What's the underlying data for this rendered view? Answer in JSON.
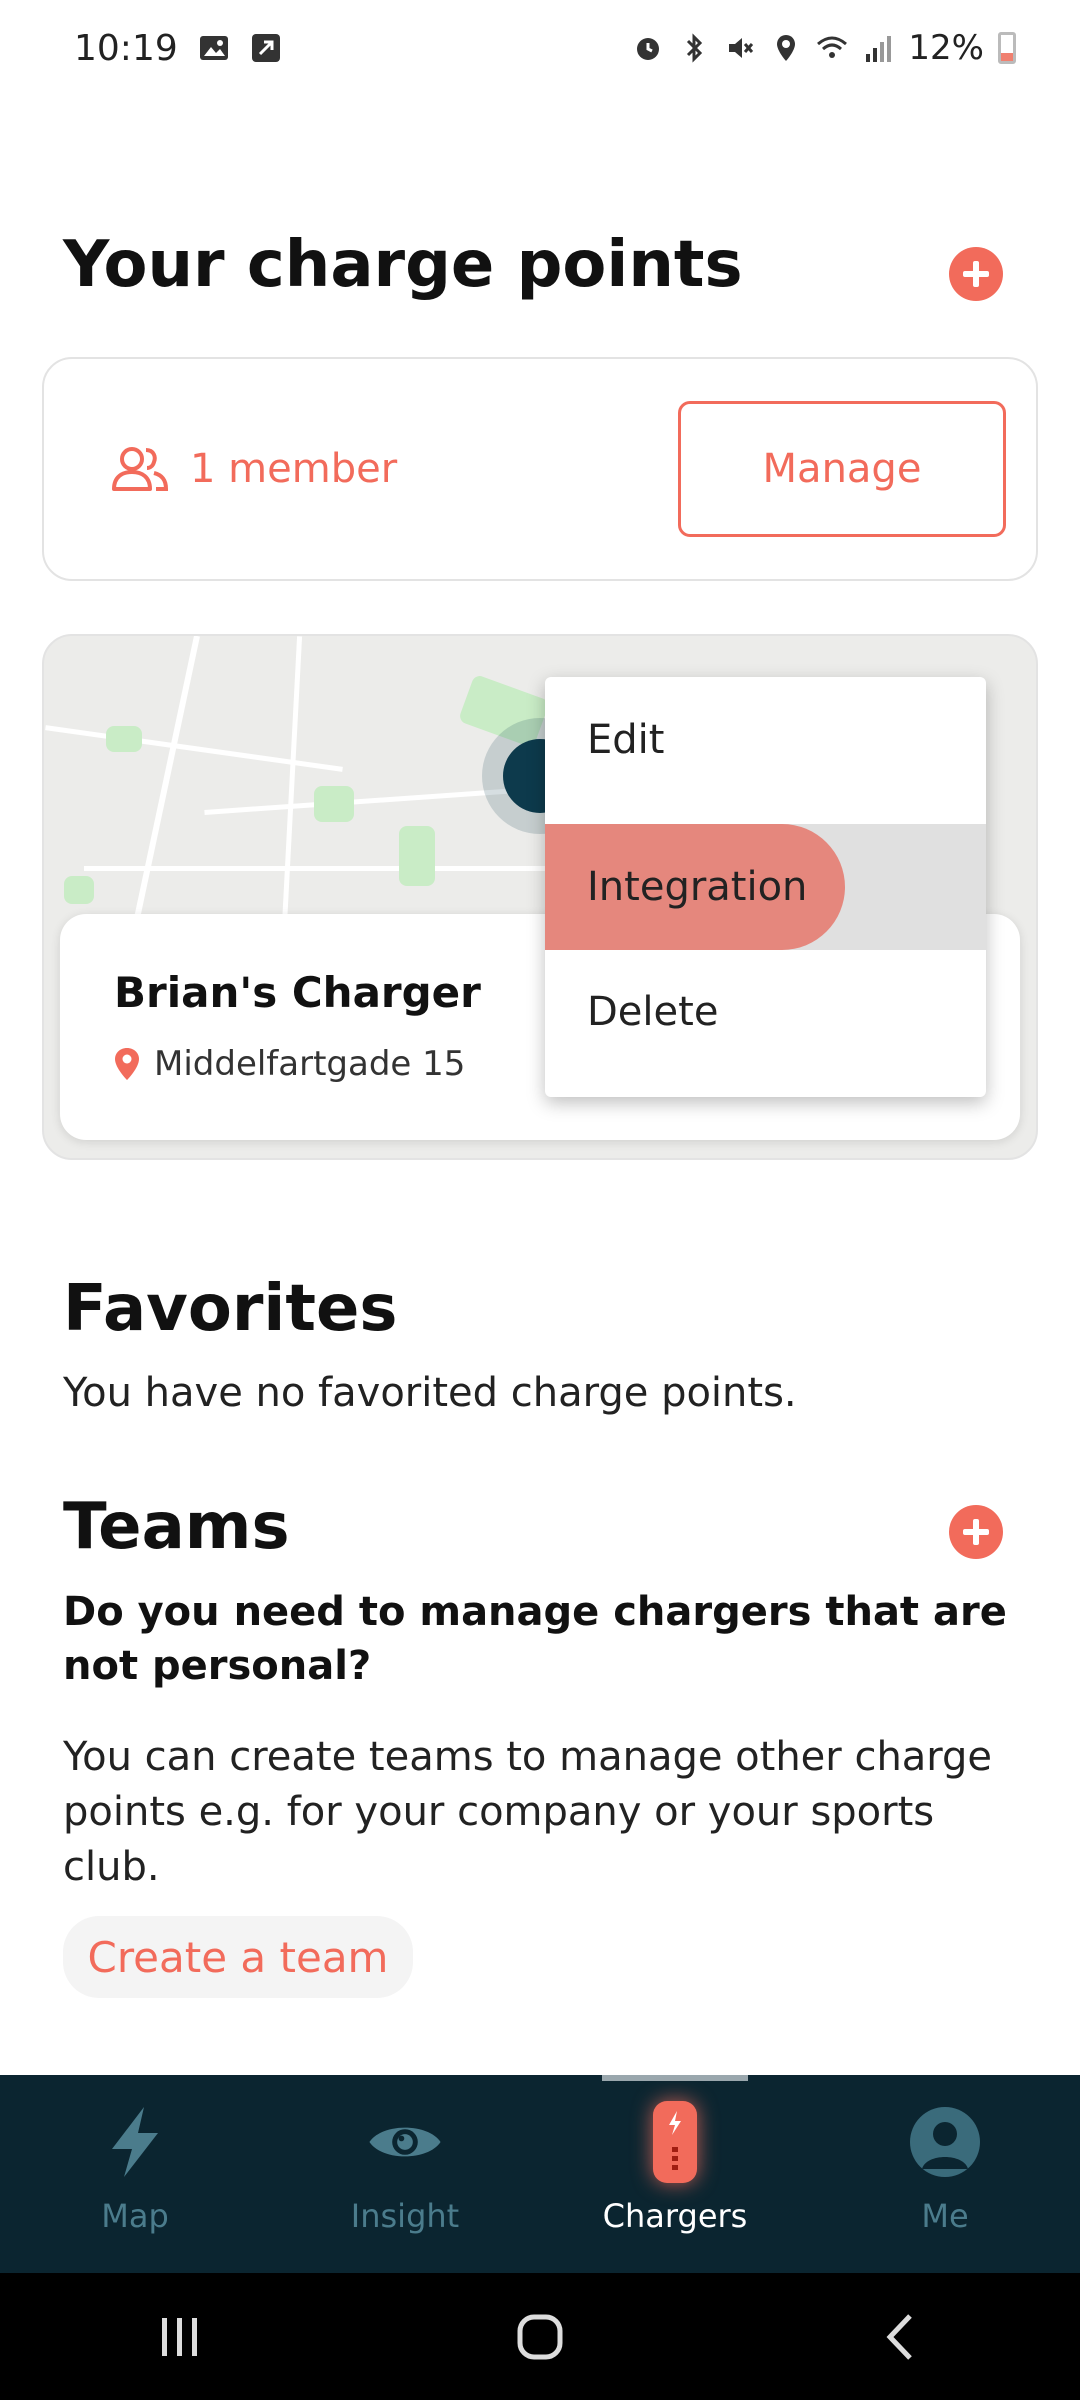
{
  "status_bar": {
    "time": "10:19",
    "battery": "12%"
  },
  "charge_points": {
    "title": "Your charge points",
    "members_label": "1 member",
    "manage_label": "Manage"
  },
  "charger": {
    "name": "Brian's Charger",
    "address": "Middelfartgade 15"
  },
  "context_menu": {
    "items": [
      "Edit",
      "Integration",
      "Delete"
    ],
    "active_index": 1
  },
  "favorites": {
    "title": "Favorites",
    "empty_text": "You have no favorited charge points."
  },
  "teams": {
    "title": "Teams",
    "question": "Do you need to manage chargers that are not personal?",
    "description": "You can create teams to manage other charge points e.g. for your company or your sports club.",
    "create_label": "Create a team"
  },
  "bottom_nav": {
    "items": [
      "Map",
      "Insight",
      "Chargers",
      "Me"
    ],
    "active": "Chargers"
  },
  "colors": {
    "accent": "#f26b5b",
    "nav_bg": "#0b2530",
    "nav_inactive": "#4b7c8c"
  }
}
